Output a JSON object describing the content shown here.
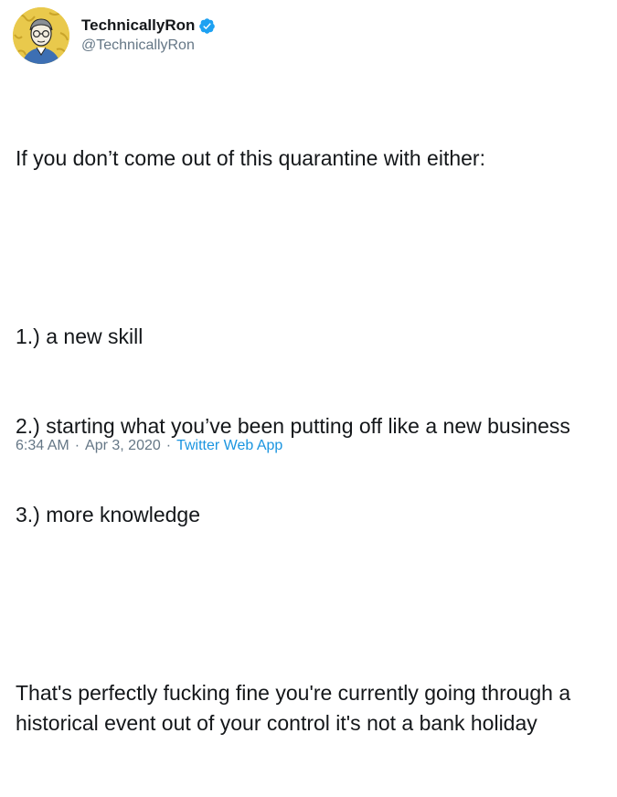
{
  "user": {
    "display_name": "TechnicallyRon",
    "handle": "@TechnicallyRon",
    "verified_icon": "verified-badge-icon",
    "avatar_icon": "avatar-illustration"
  },
  "tweet": {
    "intro": "If you don’t come out of this quarantine with either:",
    "items": [
      "1.) a new skill",
      "2.) starting what you’ve been putting off like a new business",
      "3.) more knowledge"
    ],
    "closing": "That's perfectly fucking fine you're currently going through a historical event out of your control it's not a bank holiday"
  },
  "meta": {
    "time": "6:34 AM",
    "separator": "·",
    "date": "Apr 3, 2020",
    "source": "Twitter Web App"
  },
  "colors": {
    "text": "#14171a",
    "secondary": "#657786",
    "link": "#1b95e0",
    "verified": "#1da1f2",
    "avatar_bg": "#e9c94c"
  }
}
